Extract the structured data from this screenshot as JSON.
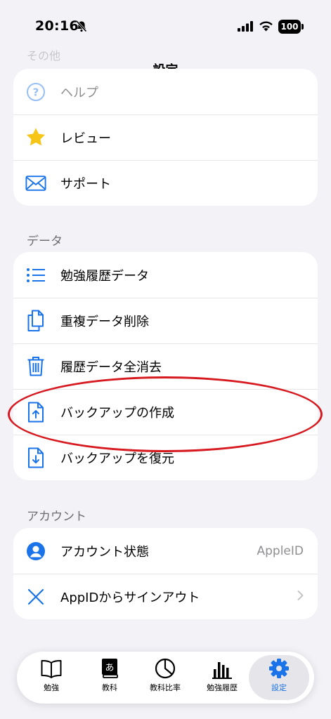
{
  "status_bar": {
    "time": "20:16",
    "battery": "100"
  },
  "nav": {
    "title": "設定",
    "ghost_section": "その他"
  },
  "other_section": {
    "items": [
      {
        "label": "ヘルプ",
        "icon": "help-icon"
      },
      {
        "label": "レビュー",
        "icon": "star-icon"
      },
      {
        "label": "サポート",
        "icon": "mail-icon"
      }
    ]
  },
  "data_section": {
    "header": "データ",
    "items": [
      {
        "label": "勉強履歴データ",
        "icon": "list-icon"
      },
      {
        "label": "重複データ削除",
        "icon": "duplicate-doc-icon"
      },
      {
        "label": "履歴データ全消去",
        "icon": "trash-icon"
      },
      {
        "label": "バックアップの作成",
        "icon": "doc-upload-icon"
      },
      {
        "label": "バックアップを復元",
        "icon": "doc-download-icon"
      }
    ]
  },
  "account_section": {
    "header": "アカウント",
    "items": [
      {
        "label": "アカウント状態",
        "value": "AppleID",
        "icon": "person-icon"
      },
      {
        "label": "AppIDからサインアウト",
        "icon": "close-icon"
      }
    ]
  },
  "tabbar": {
    "tabs": [
      {
        "label": "勉強",
        "icon": "book-icon"
      },
      {
        "label": "教科",
        "icon": "dictionary-icon",
        "glyph": "あ"
      },
      {
        "label": "教科比率",
        "icon": "pie-chart-icon"
      },
      {
        "label": "勉強履歴",
        "icon": "bar-chart-icon"
      },
      {
        "label": "設定",
        "icon": "gear-icon"
      }
    ],
    "active": "設定"
  },
  "colors": {
    "accent": "#1a73e8",
    "annotation": "#d71920",
    "star": "#f5c518",
    "background": "#f2f2f7"
  }
}
